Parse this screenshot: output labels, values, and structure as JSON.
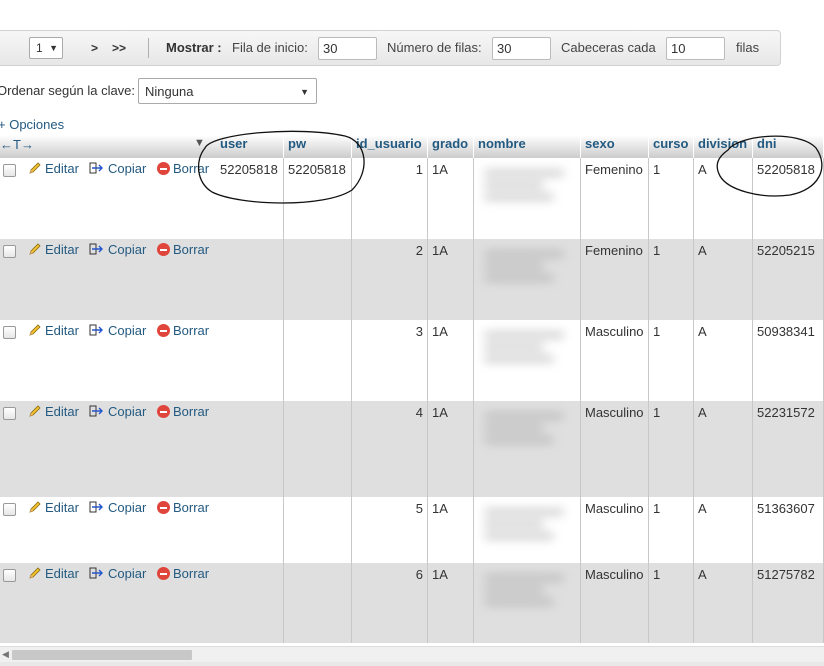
{
  "nav": {
    "page_value": "1",
    "next_label": ">",
    "last_label": ">>",
    "mostrar_label": "Mostrar :",
    "fila_inicio_label": "Fila de inicio:",
    "fila_inicio_value": "30",
    "num_filas_label": "Número de filas:",
    "num_filas_value": "30",
    "cabeceras_label": "Cabeceras cada",
    "cabeceras_value": "10",
    "filas_label": "filas"
  },
  "sort": {
    "label": "Ordenar según la clave:",
    "value": "Ninguna"
  },
  "options_label": "+ Opciones",
  "actions": {
    "edit": "Editar",
    "copy": "Copiar",
    "delete": "Borrar"
  },
  "columns": [
    "user",
    "pw",
    "id_usuario",
    "grado",
    "nombre",
    "sexo",
    "curso",
    "division",
    "dni"
  ],
  "rows": [
    {
      "user": "52205818",
      "pw": "52205818",
      "id_usuario": "1",
      "grado": "1A",
      "sexo": "Femenino",
      "curso": "1",
      "division": "A",
      "dni": "52205818"
    },
    {
      "user": "",
      "pw": "",
      "id_usuario": "2",
      "grado": "1A",
      "sexo": "Femenino",
      "curso": "1",
      "division": "A",
      "dni": "52205215"
    },
    {
      "user": "",
      "pw": "",
      "id_usuario": "3",
      "grado": "1A",
      "sexo": "Masculino",
      "curso": "1",
      "division": "A",
      "dni": "50938341"
    },
    {
      "user": "",
      "pw": "",
      "id_usuario": "4",
      "grado": "1A",
      "sexo": "Masculino",
      "curso": "1",
      "division": "A",
      "dni": "52231572"
    },
    {
      "user": "",
      "pw": "",
      "id_usuario": "5",
      "grado": "1A",
      "sexo": "Masculino",
      "curso": "1",
      "division": "A",
      "dni": "51363607"
    },
    {
      "user": "",
      "pw": "",
      "id_usuario": "6",
      "grado": "1A",
      "sexo": "Masculino",
      "curso": "1",
      "division": "A",
      "dni": "51275782"
    }
  ],
  "colors": {
    "link": "#235a81",
    "row_even": "#dfdfdf",
    "delete_icon": "#e0453c"
  }
}
